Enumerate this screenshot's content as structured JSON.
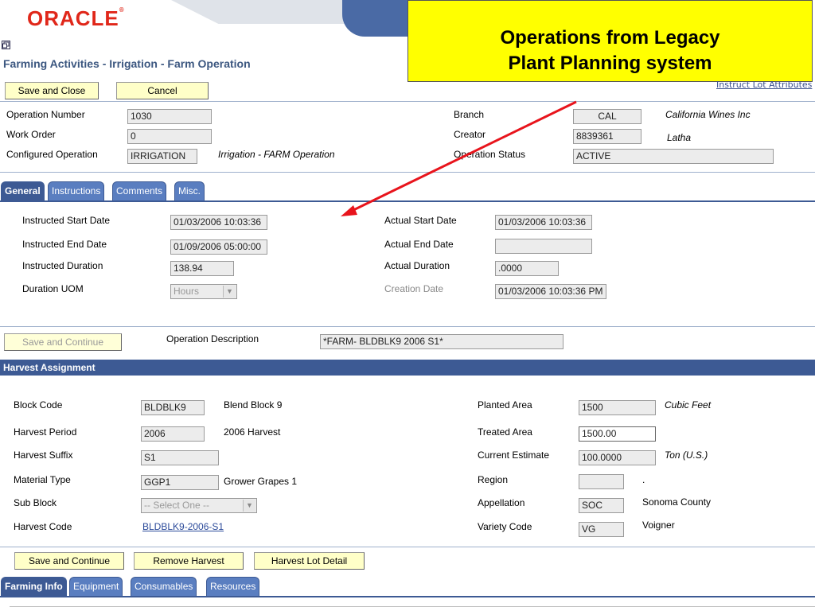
{
  "header": {
    "logo_text": "ORACLE",
    "logo_mark": "®",
    "callout_line1": "Operations from Legacy",
    "callout_line2": "Plant Planning system",
    "new_window_icon": "new-window-icon",
    "page_title": "Farming Activities - Irrigation - Farm Operation",
    "instruct_link": "Instruct Lot Attributes"
  },
  "toolbar": {
    "save_close": "Save and Close",
    "cancel": "Cancel"
  },
  "operation": {
    "number_label": "Operation Number",
    "number_value": "1030",
    "work_order_label": "Work Order",
    "work_order_value": "0",
    "configured_label": "Configured Operation",
    "configured_value": "IRRIGATION",
    "configured_desc": "Irrigation - FARM Operation",
    "branch_label": "Branch",
    "branch_value": "CAL",
    "branch_desc": "California Wines Inc",
    "creator_label": "Creator",
    "creator_value": "8839361",
    "creator_desc": "Latha",
    "status_label": "Operation Status",
    "status_value": "ACTIVE"
  },
  "tabs1": [
    "General",
    "Instructions",
    "Comments",
    "Misc."
  ],
  "general": {
    "inst_start_label": "Instructed Start Date",
    "inst_start_value": "01/03/2006 10:03:36",
    "inst_end_label": "Instructed End Date",
    "inst_end_value": "01/09/2006 05:00:00",
    "inst_dur_label": "Instructed Duration",
    "inst_dur_value": "138.94",
    "uom_label": "Duration UOM",
    "uom_value": "Hours",
    "act_start_label": "Actual Start Date",
    "act_start_value": "01/03/2006 10:03:36",
    "act_end_label": "Actual End Date",
    "act_end_value": "",
    "act_dur_label": "Actual Duration",
    "act_dur_value": ".0000",
    "created_label": "Creation Date",
    "created_value": "01/03/2006 10:03:36 PM"
  },
  "opdesc": {
    "save_continue": "Save and Continue",
    "label": "Operation Description",
    "value": "*FARM- BLDBLK9 2006 S1*"
  },
  "harvest": {
    "section_title": "Harvest Assignment",
    "block_label": "Block Code",
    "block_value": "BLDBLK9",
    "block_desc": "Blend Block 9",
    "period_label": "Harvest Period",
    "period_value": "2006",
    "period_desc": "2006 Harvest",
    "suffix_label": "Harvest Suffix",
    "suffix_value": "S1",
    "material_label": "Material Type",
    "material_value": "GGP1",
    "material_desc": "Grower Grapes 1",
    "subblock_label": "Sub Block",
    "subblock_value": "-- Select One --",
    "code_label": "Harvest Code",
    "code_value": "BLDBLK9-2006-S1",
    "planted_label": "Planted Area",
    "planted_value": "1500",
    "planted_unit": "Cubic Feet",
    "treated_label": "Treated Area",
    "treated_value": "1500.00",
    "estimate_label": "Current Estimate",
    "estimate_value": "100.0000",
    "estimate_unit": "Ton (U.S.)",
    "region_label": "Region",
    "region_value": "",
    "region_desc": ".",
    "appellation_label": "Appellation",
    "appellation_value": "SOC",
    "appellation_desc": "Sonoma County",
    "variety_label": "Variety Code",
    "variety_value": "VG",
    "variety_desc": "Voigner"
  },
  "harvest_buttons": {
    "save_continue": "Save and Continue",
    "remove": "Remove Harvest",
    "lot_detail": "Harvest Lot Detail"
  },
  "tabs2": [
    "Farming Info",
    "Equipment",
    "Consumables",
    "Resources"
  ],
  "colors": {
    "tab_blue": "#5a7ec0",
    "tab_dark": "#3d5a94",
    "button_yellow": "#ffffc8",
    "callout_yellow": "#ffff00",
    "oracle_red": "#e0271a"
  }
}
